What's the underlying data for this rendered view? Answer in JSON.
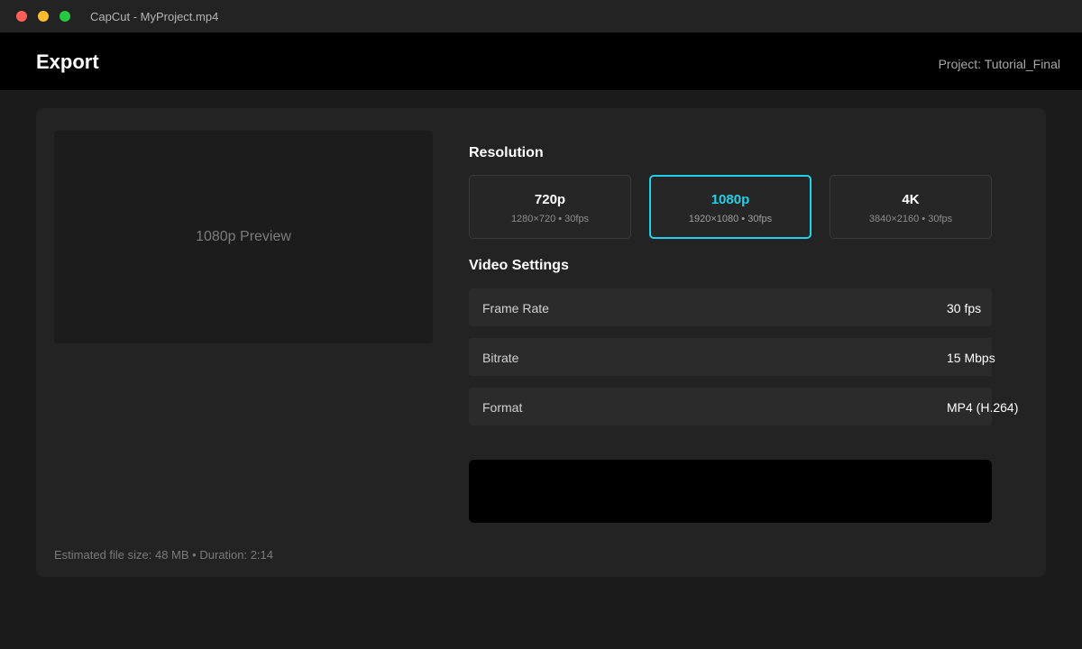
{
  "window": {
    "title": "CapCut - MyProject.mp4"
  },
  "header": {
    "title": "Export",
    "project": "Project: Tutorial_Final"
  },
  "preview": {
    "label": "1080p Preview"
  },
  "resolution": {
    "title": "Resolution",
    "selected": "1080p",
    "options": [
      {
        "name": "720p",
        "detail": "1280×720 • 30fps"
      },
      {
        "name": "1080p",
        "detail": "1920×1080 • 30fps"
      },
      {
        "name": "4K",
        "detail": "3840×2160 • 30fps"
      }
    ]
  },
  "video_settings": {
    "title": "Video Settings",
    "rows": [
      {
        "label": "Frame Rate",
        "value": "30 fps"
      },
      {
        "label": "Bitrate",
        "value": "15 Mbps"
      },
      {
        "label": "Format",
        "value": "MP4 (H.264)"
      }
    ]
  },
  "footer": {
    "info": "Estimated file size: 48 MB • Duration: 2:14"
  },
  "colors": {
    "accent": "#1fd2ea",
    "background": "#1b1b1b",
    "panel": "#232323"
  }
}
